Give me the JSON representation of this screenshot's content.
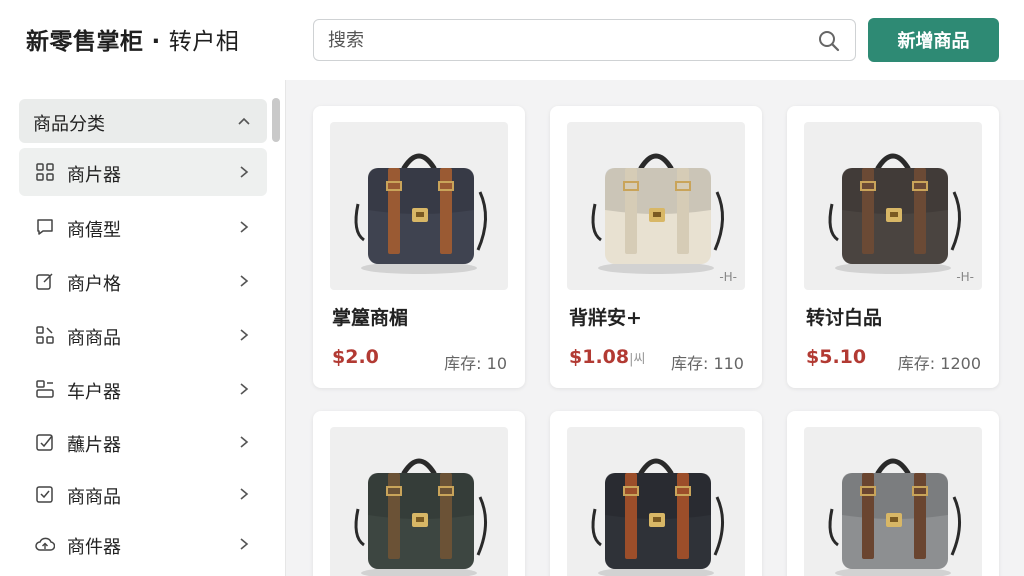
{
  "header": {
    "app_name": "新零售掌柜",
    "separator": "·",
    "subtitle": "转户相",
    "search_placeholder": "搜索",
    "add_button": "新增商品"
  },
  "sidebar": {
    "category_header": "商品分类",
    "items": [
      {
        "label": "商片器",
        "icon": "grid-icon"
      },
      {
        "label": "商僖型",
        "icon": "chat-icon"
      },
      {
        "label": "商户格",
        "icon": "edit-square-icon"
      },
      {
        "label": "商商品",
        "icon": "apps-icon"
      },
      {
        "label": "车户器",
        "icon": "user-card-icon"
      },
      {
        "label": "蘸片器",
        "icon": "checked-square-icon"
      },
      {
        "label": "商商品",
        "icon": "check-square-icon"
      },
      {
        "label": "商件器",
        "icon": "cloud-upload-icon"
      }
    ]
  },
  "products": [
    {
      "name": "掌箼商楣",
      "price": "$2.0",
      "stock": "库存: 10",
      "badge": "",
      "bag_color": "#3f4350",
      "strap_color": "#9a5a33"
    },
    {
      "name": "背牂安+",
      "price": "$1.08",
      "price_suffix": "|씨",
      "stock": "库存: 110",
      "badge": "-H-",
      "bag_color": "#e8e1d1",
      "strap_color": "#d6ccb6"
    },
    {
      "name": "转讨白品",
      "price": "$5.10",
      "stock": "库存: 1200",
      "badge": "-H-",
      "bag_color": "#4a4440",
      "strap_color": "#6b4a35"
    },
    {
      "name": "",
      "price": "",
      "stock": "",
      "badge": "",
      "bag_color": "#3d4641",
      "strap_color": "#6b5236"
    },
    {
      "name": "",
      "price": "",
      "stock": "",
      "badge": "",
      "bag_color": "#2f3238",
      "strap_color": "#9c4e2a"
    },
    {
      "name": "",
      "price": "",
      "stock": "",
      "badge": "",
      "bag_color": "#8d8f91",
      "strap_color": "#6a4530"
    }
  ],
  "colors": {
    "accent": "#2e8a74",
    "price": "#b23a33"
  }
}
